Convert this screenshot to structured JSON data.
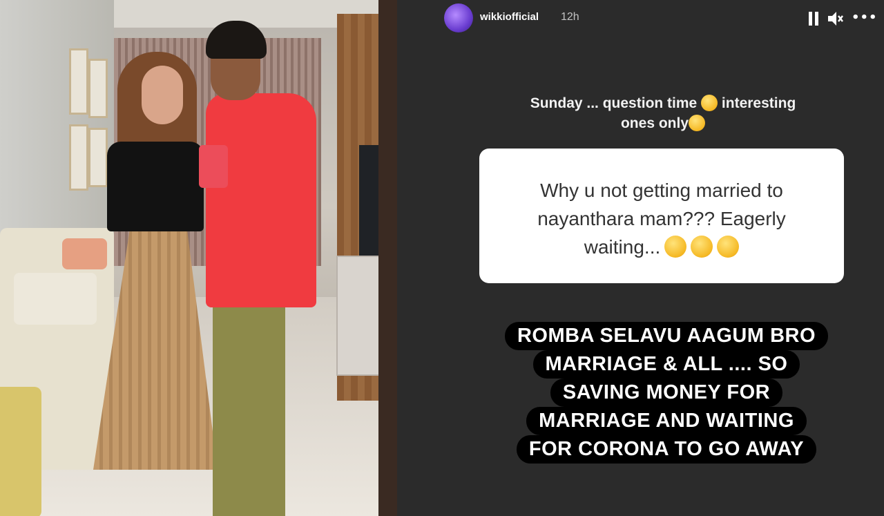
{
  "story": {
    "username": "wikkiofficial",
    "time_ago": "12h",
    "caption_line1": "Sunday ... question time",
    "caption_line1b": "interesting",
    "caption_line2": "ones only",
    "question_line1": "Why u not getting married to",
    "question_line2": "nayanthara mam??? Eagerly",
    "question_line3": "waiting...",
    "answer_lines": [
      "ROMBA SELAVU AAGUM BRO",
      "MARRIAGE & ALL .... SO",
      "SAVING MONEY FOR",
      "MARRIAGE AND WAITING",
      "FOR CORONA TO GO AWAY"
    ]
  },
  "icons": {
    "pause": "pause-icon",
    "volume": "volume-icon",
    "more": "more-icon",
    "more_glyph": "•••"
  },
  "colors": {
    "story_bg": "#2b2b2b",
    "answer_bg": "#000000",
    "question_card_bg": "#ffffff"
  }
}
